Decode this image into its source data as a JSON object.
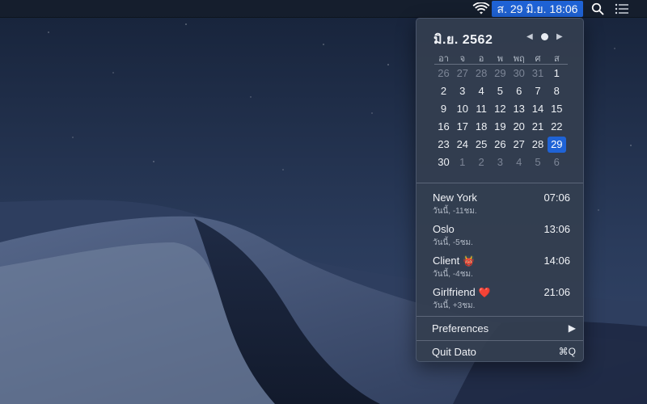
{
  "menubar": {
    "clock_text": "ส. 29 มิ.ย.  18:06",
    "accent_color": "#1f63d6",
    "icons": [
      "wifi-icon",
      "spotlight-search-icon",
      "notification-center-icon"
    ]
  },
  "calendar": {
    "title": "มิ.ย. 2562",
    "nav": {
      "prev": "◀",
      "next": "▶"
    },
    "weekdays": [
      "อา",
      "จ",
      "อ",
      "พ",
      "พฤ",
      "ศ",
      "ส"
    ],
    "weeks": [
      [
        {
          "d": "26",
          "out": true
        },
        {
          "d": "27",
          "out": true
        },
        {
          "d": "28",
          "out": true
        },
        {
          "d": "29",
          "out": true
        },
        {
          "d": "30",
          "out": true
        },
        {
          "d": "31",
          "out": true
        },
        {
          "d": "1"
        }
      ],
      [
        {
          "d": "2"
        },
        {
          "d": "3"
        },
        {
          "d": "4"
        },
        {
          "d": "5"
        },
        {
          "d": "6"
        },
        {
          "d": "7"
        },
        {
          "d": "8"
        }
      ],
      [
        {
          "d": "9"
        },
        {
          "d": "10"
        },
        {
          "d": "11"
        },
        {
          "d": "12"
        },
        {
          "d": "13"
        },
        {
          "d": "14"
        },
        {
          "d": "15"
        }
      ],
      [
        {
          "d": "16"
        },
        {
          "d": "17"
        },
        {
          "d": "18"
        },
        {
          "d": "19"
        },
        {
          "d": "20"
        },
        {
          "d": "21"
        },
        {
          "d": "22"
        }
      ],
      [
        {
          "d": "23"
        },
        {
          "d": "24"
        },
        {
          "d": "25"
        },
        {
          "d": "26"
        },
        {
          "d": "27"
        },
        {
          "d": "28"
        },
        {
          "d": "29",
          "today": true
        }
      ],
      [
        {
          "d": "30"
        },
        {
          "d": "1",
          "out": true
        },
        {
          "d": "2",
          "out": true
        },
        {
          "d": "3",
          "out": true
        },
        {
          "d": "4",
          "out": true
        },
        {
          "d": "5",
          "out": true
        },
        {
          "d": "6",
          "out": true
        }
      ]
    ]
  },
  "world_clocks": [
    {
      "name": "New York",
      "offset": "วันนี้, -11ชม.",
      "time": "07:06",
      "emoji": ""
    },
    {
      "name": "Oslo",
      "offset": "วันนี้, -5ชม.",
      "time": "13:06",
      "emoji": ""
    },
    {
      "name": "Client",
      "offset": "วันนี้, -4ชม.",
      "time": "14:06",
      "emoji": "👹"
    },
    {
      "name": "Girlfriend",
      "offset": "วันนี้, +3ชม.",
      "time": "21:06",
      "emoji": "❤️"
    }
  ],
  "menu": {
    "preferences_label": "Preferences",
    "preferences_arrow": "▶",
    "quit_label": "Quit Dato",
    "quit_shortcut": "⌘Q"
  }
}
